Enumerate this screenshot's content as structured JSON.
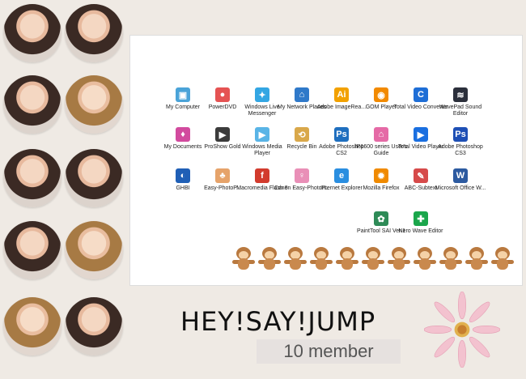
{
  "banner": {
    "title": "HEY!SAY!JUMP",
    "subtitle": "10 member"
  },
  "desktop": {
    "icons": [
      {
        "label": "My Computer",
        "icon": "computer-icon",
        "color": "#4aa3d8"
      },
      {
        "label": "PowerDVD",
        "icon": "powerdvd-icon",
        "color": "#e55353"
      },
      {
        "label": "Windows Live Messenger",
        "icon": "messenger-icon",
        "color": "#33a6e3"
      },
      {
        "label": "My Network Places",
        "icon": "network-icon",
        "color": "#2f79c9"
      },
      {
        "label": "Adobe ImageRea...",
        "icon": "imageready-icon",
        "color": "#f2a100"
      },
      {
        "label": "GOM Player",
        "icon": "gom-player-icon",
        "color": "#f28a00"
      },
      {
        "label": "Total Video Converter",
        "icon": "video-converter-icon",
        "color": "#1e6ed6"
      },
      {
        "label": "WavePad Sound Editor",
        "icon": "wavepad-icon",
        "color": "#2b2f3b"
      },
      {
        "label": "My Documents",
        "icon": "documents-icon",
        "color": "#d24a9e"
      },
      {
        "label": "ProShow Gold",
        "icon": "proshow-icon",
        "color": "#3b3b3b"
      },
      {
        "label": "Windows Media Player",
        "icon": "media-player-icon",
        "color": "#59b4e6"
      },
      {
        "label": "Recycle Bin",
        "icon": "recycle-bin-icon",
        "color": "#d9a84a"
      },
      {
        "label": "Adobe Photoshop CS2",
        "icon": "photoshop-icon",
        "color": "#1f6fbf"
      },
      {
        "label": "IP1600 series User's Guide",
        "icon": "ip1600-icon",
        "color": "#e56aa6"
      },
      {
        "label": "Total Video Player",
        "icon": "video-player-icon",
        "color": "#1a6fe0"
      },
      {
        "label": "Adobe Photoshop CS3",
        "icon": "photoshop-cs3-icon",
        "color": "#1e4fb5"
      },
      {
        "label": "GHBI",
        "icon": "ghbi-icon",
        "color": "#1f5fb6"
      },
      {
        "label": "Easy-PhotoP...",
        "icon": "photoprint-icon",
        "color": "#e6a36a"
      },
      {
        "label": "Macromedia Flash 8",
        "icon": "flash-icon",
        "color": "#d23b2d"
      },
      {
        "label": "Canon Easy-PhotoP...",
        "icon": "canon-icon",
        "color": "#e98fb7"
      },
      {
        "label": "Internet Explorer",
        "icon": "ie-icon",
        "color": "#2a8ee0"
      },
      {
        "label": "Mozilla Firefox",
        "icon": "firefox-icon",
        "color": "#f08a00"
      },
      {
        "label": "ABC-Subtext",
        "icon": "abc-icon",
        "color": "#d64a4a"
      },
      {
        "label": "Microsoft Office W...",
        "icon": "word-icon",
        "color": "#2c5aa0"
      },
      {
        "label": "PaintTool SAI Ver.1",
        "icon": "sai-icon",
        "color": "#2e8b57"
      },
      {
        "label": "Nero Wave Editor",
        "icon": "nero-icon",
        "color": "#1aa64b"
      }
    ]
  }
}
